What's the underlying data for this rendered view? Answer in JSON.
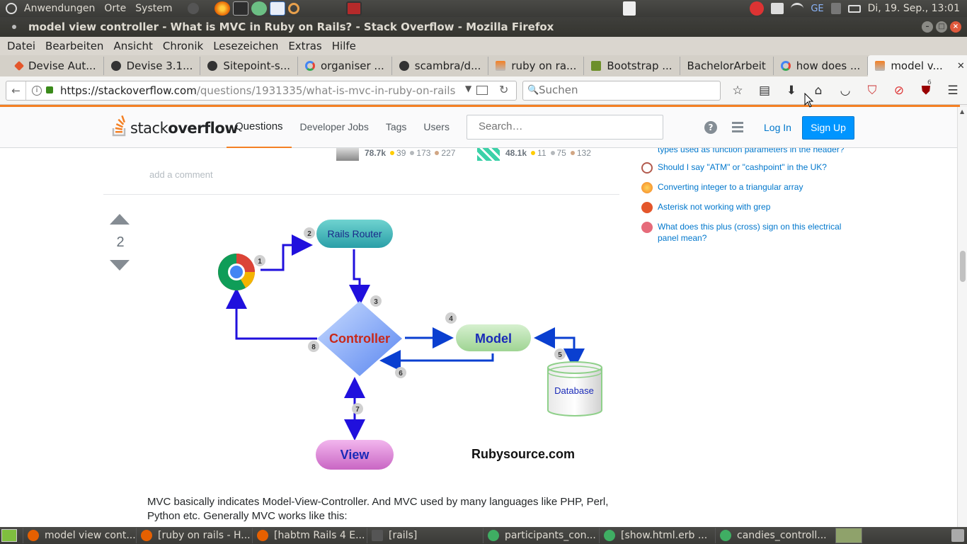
{
  "system_panel": {
    "menus": [
      "Anwendungen",
      "Orte",
      "System"
    ],
    "clock": "Di, 19. Sep., 13:01",
    "keyboard_layout": "GE"
  },
  "window": {
    "title": "model view controller - What is MVC in Ruby on Rails? - Stack Overflow - Mozilla Firefox"
  },
  "menubar": [
    "Datei",
    "Bearbeiten",
    "Ansicht",
    "Chronik",
    "Lesezeichen",
    "Extras",
    "Hilfe"
  ],
  "tabs": [
    {
      "label": "Devise Aut...",
      "icon": "devise-icon",
      "color": "#e4562b"
    },
    {
      "label": "Devise 3.1...",
      "icon": "github-icon",
      "color": "#333333"
    },
    {
      "label": "Sitepoint-s...",
      "icon": "github-icon",
      "color": "#333333"
    },
    {
      "label": "organiser ...",
      "icon": "google-icon",
      "color": "#4285f4"
    },
    {
      "label": "scambra/d...",
      "icon": "github-icon",
      "color": "#333333"
    },
    {
      "label": "ruby on ra...",
      "icon": "stackoverflow-icon",
      "color": "#f48024"
    },
    {
      "label": "Bootstrap ...",
      "icon": "bootstrap-icon",
      "color": "#6d8f2a"
    },
    {
      "label": "BachelorArbeit",
      "icon": "",
      "color": ""
    },
    {
      "label": "how does ...",
      "icon": "google-icon",
      "color": "#4285f4"
    },
    {
      "label": "model v...",
      "icon": "stackoverflow-icon",
      "color": "#f48024",
      "active": true
    }
  ],
  "navbar": {
    "url_host": "https://stackoverflow.com",
    "url_path": "/questions/1931335/what-is-mvc-in-ruby-on-rails",
    "search_placeholder": "Suchen",
    "ublock_count": "6"
  },
  "so_header": {
    "logo_light": "stack",
    "logo_bold": "overflow",
    "nav": [
      "Questions",
      "Developer Jobs",
      "Tags",
      "Users"
    ],
    "search_placeholder": "Search…",
    "login": "Log In",
    "signup": "Sign Up"
  },
  "users": [
    {
      "rep": "78.7k",
      "gold": "39",
      "silver": "173",
      "bronze": "227"
    },
    {
      "rep": "48.1k",
      "gold": "11",
      "silver": "75",
      "bronze": "132"
    }
  ],
  "add_comment": "add a comment",
  "vote_count": "2",
  "diagram": {
    "rails_router": "Rails Router",
    "controller": "Controller",
    "model": "Model",
    "database": "Database",
    "view": "View",
    "credit": "Rubysource.com",
    "steps": [
      "1",
      "2",
      "3",
      "4",
      "5",
      "6",
      "7",
      "8"
    ]
  },
  "answer_text": "MVC basically indicates Model-View-Controller. And MVC used by many languages like PHP, Perl, Python etc. Generally MVC works like this:",
  "related": [
    {
      "text": "types used as function parameters in the header?",
      "color": "#07c"
    },
    {
      "text": "Should I say \"ATM\" or \"cashpoint\" in the UK?",
      "color": "#b25a4d"
    },
    {
      "text": "Converting integer to a triangular array",
      "color": "#f48024"
    },
    {
      "text": "Asterisk not working with grep",
      "color": "#e4562b"
    },
    {
      "text": "What does this plus (cross) sign on this electrical panel mean?",
      "color": "#e66b7a"
    }
  ],
  "taskbar": [
    {
      "label": "model view cont...",
      "color": "#e66000"
    },
    {
      "label": "[ruby on rails - H...",
      "color": "#e66000"
    },
    {
      "label": "[habtm Rails 4 E...",
      "color": "#e66000"
    },
    {
      "label": "[rails]",
      "color": "#555555"
    },
    {
      "label": "participants_con...",
      "color": "#3fae63"
    },
    {
      "label": "[show.html.erb ...",
      "color": "#3fae63"
    },
    {
      "label": "candies_controll...",
      "color": "#3fae63"
    }
  ]
}
